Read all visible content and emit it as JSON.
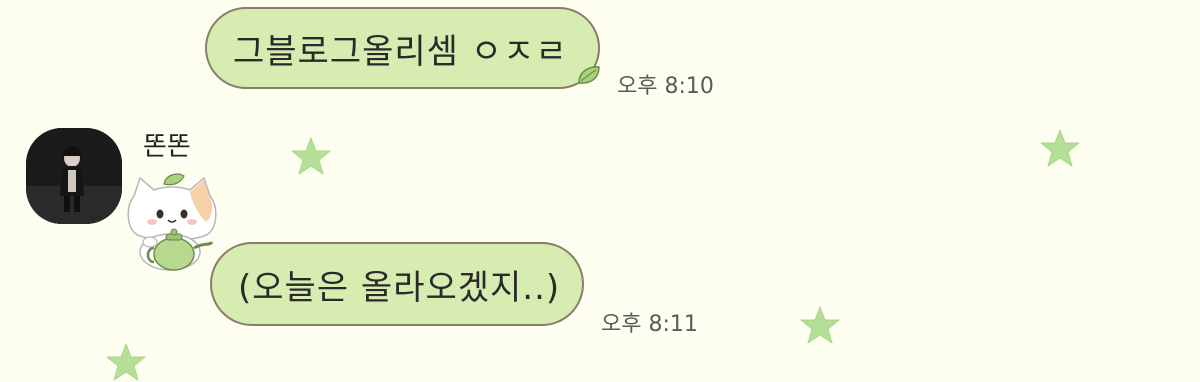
{
  "messages": [
    {
      "direction": "outgoing",
      "text": "그블로그올리셈 ㅇㅈㄹ",
      "time": "오후 8:10",
      "accent_icon": "leaf-icon"
    },
    {
      "direction": "incoming",
      "sender": "똔똔",
      "avatar_icon": "profile-photo",
      "sticker_icon": "cat-with-teapot-sticker",
      "text": "(오늘은 올라오겠지..)",
      "time": "오후 8:11"
    }
  ],
  "theme": {
    "background": "#fefef0",
    "bubble_fill": "#d7ecb0",
    "bubble_border": "#8a7d6a",
    "star_color": "#b5df96"
  }
}
